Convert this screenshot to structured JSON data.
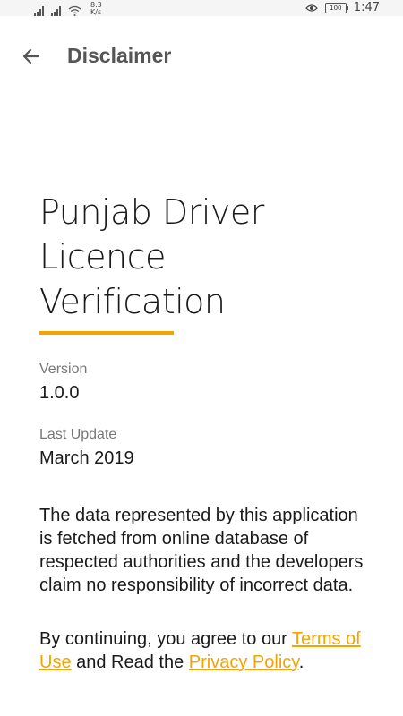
{
  "status_bar": {
    "network_speed_value": "8.3",
    "network_speed_unit": "K/s",
    "battery": "100",
    "time": "1:47"
  },
  "toolbar": {
    "back_icon": "arrow-left-icon",
    "title": "Disclaimer"
  },
  "app": {
    "title_line1": "Punjab Driver",
    "title_line2": "Licence",
    "title_line3": "Verification"
  },
  "version": {
    "label": "Version",
    "value": "1.0.0"
  },
  "last_update": {
    "label": "Last Update",
    "value": "March 2019"
  },
  "disclaimer_text": "The data represented by this application is fetched from online database of respected authorities and the developers claim no responsibility of incorrect data.",
  "agreement": {
    "prefix": "By continuing, you agree to our ",
    "terms_link": "Terms of Use",
    "middle": " and Read the ",
    "privacy_link": "Privacy Policy",
    "suffix": "."
  },
  "colors": {
    "accent": "#f5a300",
    "toolbar_title": "#555555",
    "muted_label": "#777777"
  }
}
